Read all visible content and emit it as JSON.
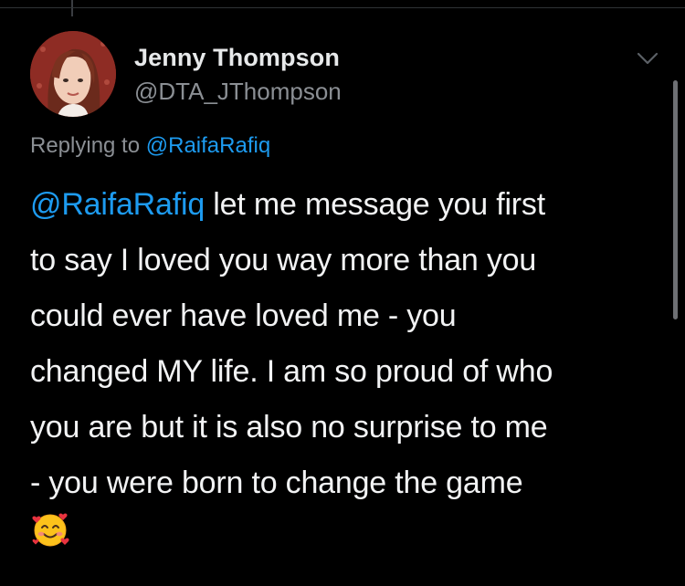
{
  "tweet": {
    "author": {
      "display_name": "Jenny Thompson",
      "handle": "@DTA_JThompson"
    },
    "replying_to": {
      "prefix": "Replying to",
      "mention": "@RaifaRafiq"
    },
    "text": {
      "mention": "@RaifaRafiq",
      "line1_rest": " let me message you first",
      "line2": "to say I loved you way more than you",
      "line3": "could ever have loved me - you",
      "line4": "changed MY life. I am so proud of who",
      "line5": "you are but it is also no surprise to me",
      "line6": "- you were born to change the game"
    },
    "emoji": "smiling-face-with-hearts-icon"
  },
  "colors": {
    "background": "#000000",
    "text": "#f2f3f4",
    "secondary": "#8b8f94",
    "accent": "#1d9bf0"
  }
}
